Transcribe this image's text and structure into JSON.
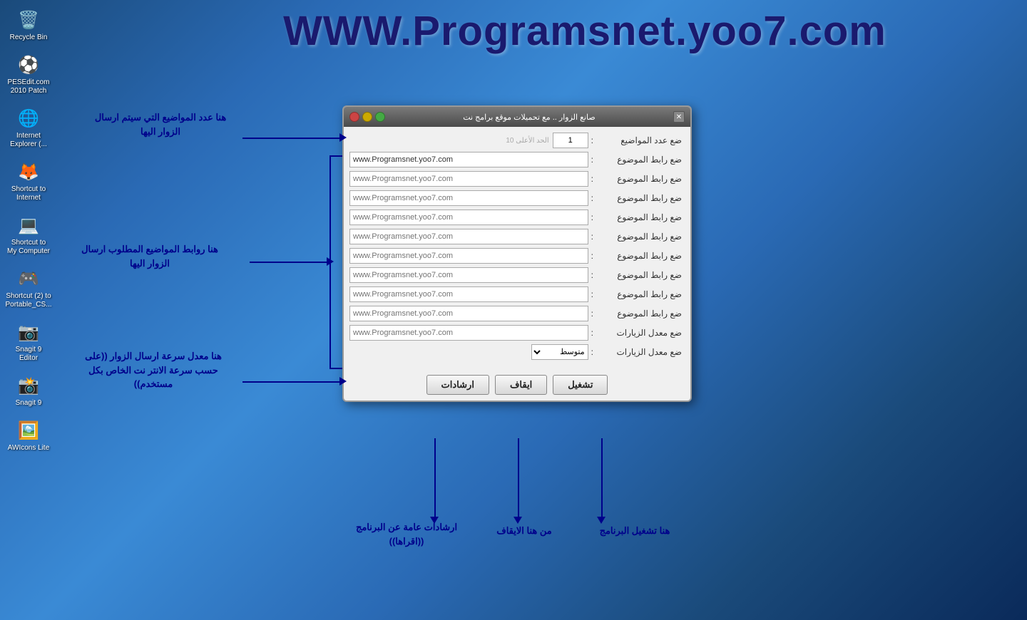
{
  "desktop": {
    "bg_color_start": "#1a4a7a",
    "bg_color_end": "#0a2a5a",
    "website_title": "WWW.Programsnet.yoo7.com"
  },
  "icons": [
    {
      "id": "recycle-bin",
      "label": "Recycle Bin",
      "icon": "🗑️"
    },
    {
      "id": "pes-edit",
      "label": "PESEdit.com 2010 Patch",
      "icon": "⚽"
    },
    {
      "id": "ie",
      "label": "Internet Explorer (...",
      "icon": "🌐"
    },
    {
      "id": "shortcut-internet",
      "label": "Shortcut to Internet",
      "icon": "🦊"
    },
    {
      "id": "shortcut-computer",
      "label": "Shortcut to My Computer",
      "icon": "💻"
    },
    {
      "id": "shortcut-cs",
      "label": "Shortcut (2) to Portable_CS...",
      "icon": "🎮"
    },
    {
      "id": "snagit-editor",
      "label": "Snagit 9 Editor",
      "icon": "📷"
    },
    {
      "id": "snagit",
      "label": "Snagit 9",
      "icon": "📸"
    },
    {
      "id": "awicons",
      "label": "AWIcons Lite",
      "icon": "🖼️"
    }
  ],
  "dialog": {
    "title": "صانع الزوار .. مع تحميلات موقع برامج نت",
    "fields": [
      {
        "label": "ضع عدد المواضيع",
        "value": "1",
        "placeholder": "الحد الأعلى 10",
        "type": "number"
      },
      {
        "label": "ضع رابط الموضوع",
        "value": "www.Programsnet.yoo7.com",
        "placeholder": "www.Programsnet.yoo7.com",
        "type": "text"
      },
      {
        "label": "ضع رابط الموضوع",
        "value": "",
        "placeholder": "www.Programsnet.yoo7.com",
        "type": "text"
      },
      {
        "label": "ضع رابط الموضوع",
        "value": "",
        "placeholder": "www.Programsnet.yoo7.com",
        "type": "text"
      },
      {
        "label": "ضع رابط الموضوع",
        "value": "",
        "placeholder": "www.Programsnet.yoo7.com",
        "type": "text"
      },
      {
        "label": "ضع رابط الموضوع",
        "value": "",
        "placeholder": "www.Programsnet.yoo7.com",
        "type": "text"
      },
      {
        "label": "ضع رابط الموضوع",
        "value": "",
        "placeholder": "www.Programsnet.yoo7.com",
        "type": "text"
      },
      {
        "label": "ضع رابط الموضوع",
        "value": "",
        "placeholder": "www.Programsnet.yoo7.com",
        "type": "text"
      },
      {
        "label": "ضع رابط الموضوع",
        "value": "",
        "placeholder": "www.Programsnet.yoo7.com",
        "type": "text"
      },
      {
        "label": "ضع رابط الموضوع",
        "value": "",
        "placeholder": "www.Programsnet.yoo7.com",
        "type": "text"
      },
      {
        "label": "ضع معدل الزيارات",
        "value": "متوسط",
        "placeholder": "",
        "type": "select"
      }
    ],
    "buttons": [
      {
        "id": "start",
        "label": "تشغيل"
      },
      {
        "id": "pause",
        "label": "ايقاف"
      },
      {
        "id": "instructions",
        "label": "ارشادات"
      }
    ]
  },
  "annotations": {
    "topics_count": "هنا عدد المواضيع التي سيتم ارسال\nالزوار اليها",
    "links": "هنا روابط المواضيع المطلوب ارسال\nالزوار اليها",
    "speed": "هنا معدل سرعة ارسال الزوار ((على\nحسب سرعة الانتر نت الخاص بكل\nمستخدم))",
    "start_btn": "هنا تشغيل البرنامج",
    "pause_btn": "من هنا الايقاف",
    "instructions_btn": "ارشادات عامة عن\nالبرنامج ((اقراها))"
  }
}
